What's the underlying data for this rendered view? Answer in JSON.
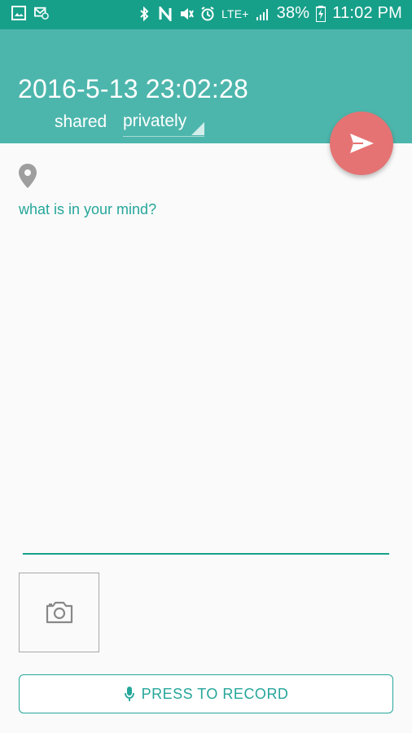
{
  "status_bar": {
    "battery": "38%",
    "time": "11:02 PM",
    "network": "LTE+"
  },
  "header": {
    "date": "2016-5-13 23:02:28",
    "shared_label": "shared",
    "privacy_value": "privately"
  },
  "editor": {
    "placeholder": "what is in your mind?"
  },
  "record": {
    "label": "PRESS TO RECORD"
  },
  "colors": {
    "status_bar": "#16a08a",
    "app_bar": "#4db6ac",
    "fab": "#e57373",
    "accent": "#26a69a"
  },
  "icons": {
    "location": "location-pin-icon",
    "send": "send-icon",
    "camera": "camera-icon",
    "mic": "mic-icon"
  }
}
